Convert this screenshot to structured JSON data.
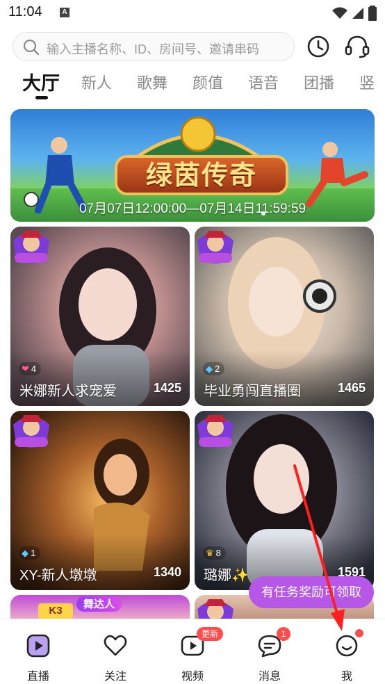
{
  "status_bar": {
    "time": "11:04",
    "notification_letter": "A"
  },
  "search": {
    "placeholder": "输入主播名称、ID、房间号、邀请串码"
  },
  "header_icons": {
    "history": "clock-icon",
    "support": "headset-icon"
  },
  "tabs": [
    {
      "label": "大厅",
      "active": true
    },
    {
      "label": "新人",
      "active": false
    },
    {
      "label": "歌舞",
      "active": false
    },
    {
      "label": "颜值",
      "active": false
    },
    {
      "label": "语音",
      "active": false
    },
    {
      "label": "团播",
      "active": false
    },
    {
      "label": "竖",
      "active": false
    }
  ],
  "banner": {
    "title": "绿茵传奇",
    "date_range": "07月07日12:00:00—07月14日11:59:59"
  },
  "cards": [
    {
      "name": "米娜新人求宠爱",
      "count": "1425",
      "gem_level": "4",
      "gem_type": "heart-gem",
      "badge": "邦女郎"
    },
    {
      "name": "毕业勇闯直播圈",
      "count": "1465",
      "gem_level": "2",
      "gem_type": "diamond",
      "badge": "邦女郎"
    },
    {
      "name": "XY-新人墩墩",
      "count": "1340",
      "gem_level": "1",
      "gem_type": "diamond",
      "badge": "邦女郎"
    },
    {
      "name": "璐娜✨",
      "count": "1591",
      "gem_level": "8",
      "gem_type": "crown",
      "badge": "邦女郎"
    }
  ],
  "partial_cards": [
    {
      "badge_text": "K3",
      "tag": "舞达人"
    },
    {
      "badge": "邦女郎"
    }
  ],
  "task_pill": {
    "label": "有任务奖励可领取"
  },
  "bottom_nav": [
    {
      "label": "直播",
      "icon": "live-play-icon",
      "active": true
    },
    {
      "label": "关注",
      "icon": "heart-icon",
      "active": false
    },
    {
      "label": "视频",
      "icon": "video-icon",
      "active": false,
      "badge": "更新"
    },
    {
      "label": "消息",
      "icon": "message-icon",
      "active": false,
      "badge": "1"
    },
    {
      "label": "我",
      "icon": "profile-icon",
      "active": false,
      "dot": true
    }
  ],
  "colors": {
    "accent_purple": "#b657e8",
    "badge_red": "#ff4d4d",
    "arrow_red": "#ff1f1f"
  }
}
